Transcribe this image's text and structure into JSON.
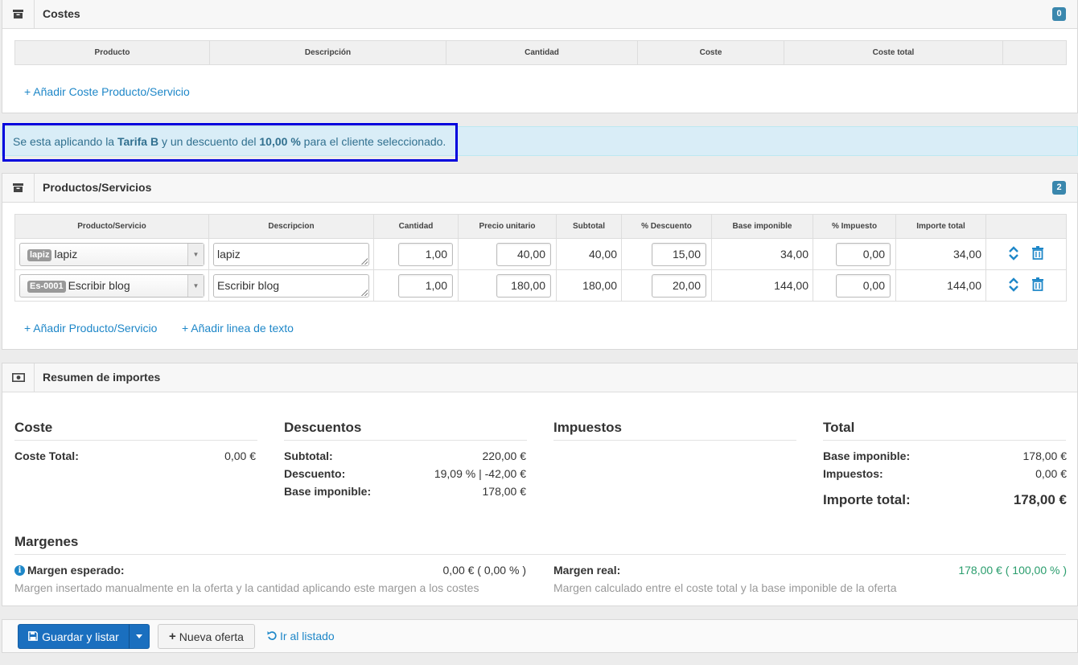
{
  "costes": {
    "title": "Costes",
    "count": "0",
    "columns": [
      "Producto",
      "Descripción",
      "Cantidad",
      "Coste",
      "Coste total",
      ""
    ],
    "add_link": "+ Añadir Coste Producto/Servicio"
  },
  "alert": {
    "prefix": "Se esta aplicando la ",
    "tarifa": "Tarifa B",
    "middle": " y un descuento del ",
    "discount": "10,00 %",
    "suffix": " para el cliente seleccionado."
  },
  "productos": {
    "title": "Productos/Servicios",
    "count": "2",
    "columns": [
      "Producto/Servicio",
      "Descripcion",
      "Cantidad",
      "Precio unitario",
      "Subtotal",
      "% Descuento",
      "Base imponible",
      "% Impuesto",
      "Importe total",
      ""
    ],
    "rows": [
      {
        "ref": "lapiz",
        "name": "lapiz",
        "descripcion": "lapiz",
        "cantidad": "1,00",
        "precio": "40,00",
        "subtotal": "40,00",
        "descuento": "15,00",
        "base": "34,00",
        "impuesto": "0,00",
        "total": "34,00"
      },
      {
        "ref": "Es-0001",
        "name": "Escribir blog",
        "descripcion": "Escribir blog",
        "cantidad": "1,00",
        "precio": "180,00",
        "subtotal": "180,00",
        "descuento": "20,00",
        "base": "144,00",
        "impuesto": "0,00",
        "total": "144,00"
      }
    ],
    "add_product_link": "+ Añadir Producto/Servicio",
    "add_text_link": "+ Añadir linea de texto"
  },
  "resumen": {
    "title": "Resumen de importes",
    "coste": {
      "heading": "Coste",
      "total_label": "Coste Total:",
      "total_value": "0,00 €"
    },
    "descuentos": {
      "heading": "Descuentos",
      "subtotal_label": "Subtotal:",
      "subtotal_value": "220,00 €",
      "descuento_label": "Descuento:",
      "descuento_value": "19,09 % | -42,00 €",
      "base_label": "Base imponible:",
      "base_value": "178,00 €"
    },
    "impuestos": {
      "heading": "Impuestos"
    },
    "total": {
      "heading": "Total",
      "base_label": "Base imponible:",
      "base_value": "178,00 €",
      "impuestos_label": "Impuestos:",
      "impuestos_value": "0,00 €",
      "importe_label": "Importe total:",
      "importe_value": "178,00 €"
    },
    "margenes": {
      "heading": "Margenes",
      "esperado_label": "Margen esperado:",
      "esperado_value": "0,00 € ( 0,00 % )",
      "esperado_help": "Margen insertado manualmente en la oferta y la cantidad aplicando este margen a los costes",
      "real_label": "Margen real:",
      "real_value": "178,00 € ( 100,00 % )",
      "real_help": "Margen calculado entre el coste total y la base imponible de la oferta"
    }
  },
  "actions": {
    "save_label": "Guardar y listar",
    "new_label": "Nueva oferta",
    "list_label": "Ir al listado"
  },
  "colors": {
    "primary": "#1a6fbf",
    "link": "#1e87c8",
    "badge": "#3a87ad",
    "alert_bg": "#d9edf7",
    "alert_border": "#0000dd",
    "success": "#2a9d6d"
  }
}
